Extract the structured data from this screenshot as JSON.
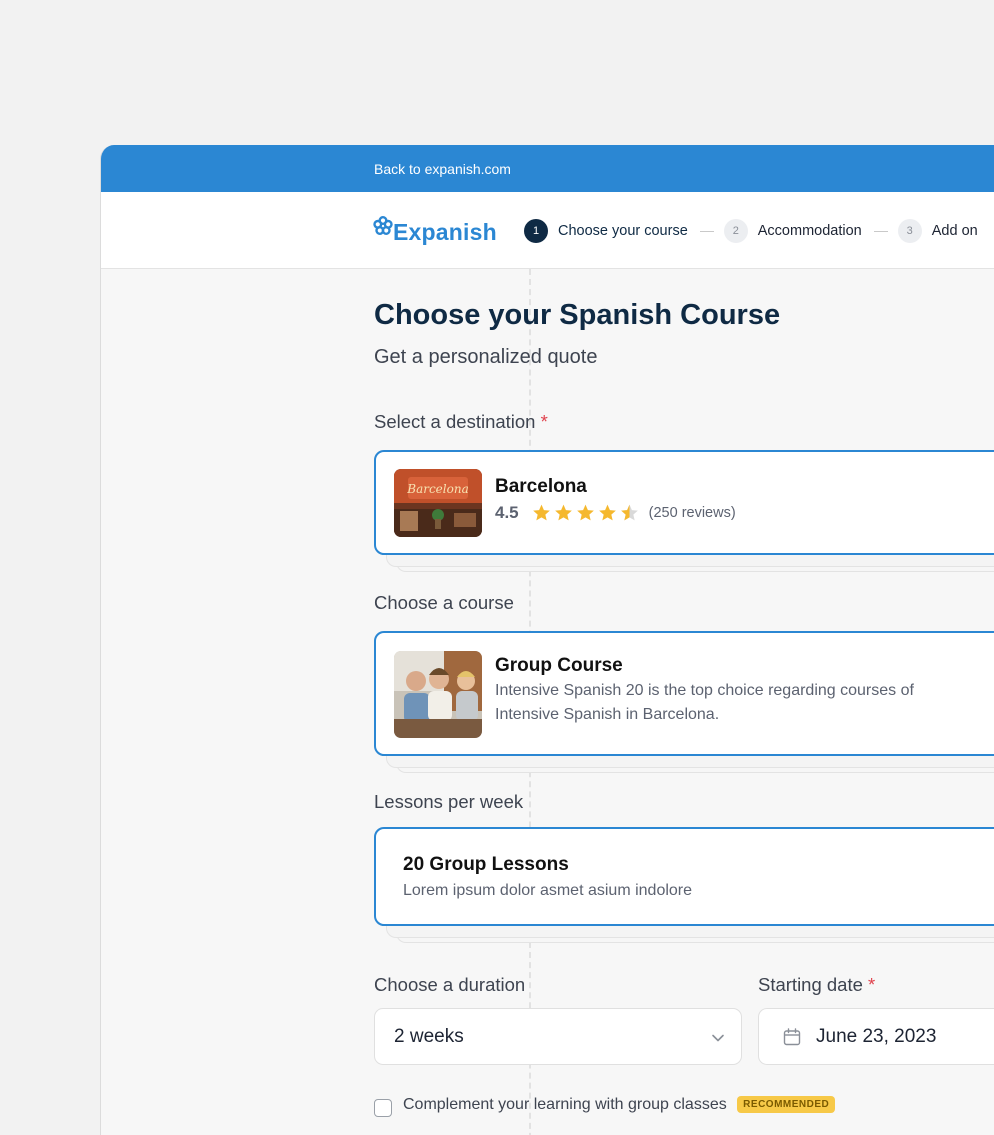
{
  "topbar": {
    "back_link": "Back to expanish.com"
  },
  "brand": {
    "name": "Expanish",
    "color": "#2b87d3"
  },
  "steps": [
    {
      "num": "1",
      "label": "Choose your course",
      "active": true
    },
    {
      "num": "2",
      "label": "Accommodation",
      "active": false
    },
    {
      "num": "3",
      "label": "Add on",
      "active": false
    }
  ],
  "page": {
    "title": "Choose your Spanish Course",
    "subtitle": "Get a personalized quote"
  },
  "destination": {
    "label": "Select a destination",
    "required_mark": "*",
    "name": "Barcelona",
    "rating": "4.5",
    "stars": 4.5,
    "reviews": "(250 reviews)"
  },
  "course": {
    "label": "Choose a course",
    "name": "Group Course",
    "description": "Intensive Spanish 20 is the top choice regarding courses of Intensive Spanish in Barcelona."
  },
  "lessons": {
    "label": "Lessons per week",
    "name": "20 Group Lessons",
    "description": "Lorem ipsum dolor asmet asium indolore"
  },
  "duration": {
    "label": "Choose a duration",
    "value": "2 weeks"
  },
  "start_date": {
    "label": "Starting date",
    "required_mark": "*",
    "value": "June 23, 2023"
  },
  "extra": {
    "label": "Complement your learning with group classes",
    "badge": "RECOMMENDED"
  }
}
